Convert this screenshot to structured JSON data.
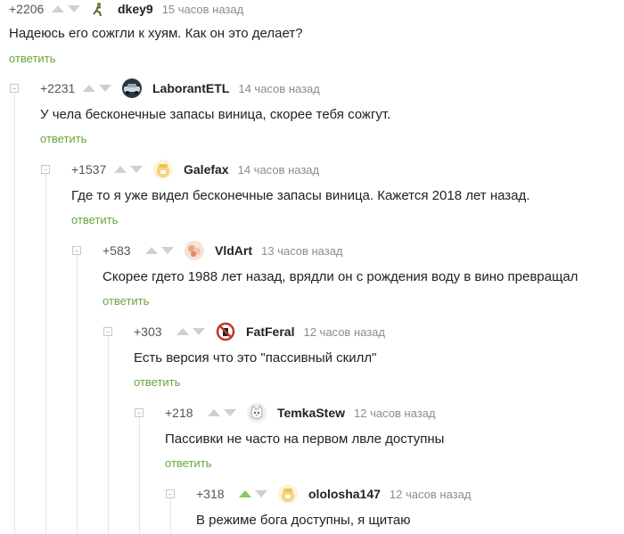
{
  "comments": [
    {
      "rating": "+2206",
      "author": "dkey9",
      "time": "15 часов назад",
      "text": "Надеюсь его сожгли к хуям. Как он это делает?",
      "reply": "ответить",
      "avatar_icon": "runner-avatar"
    },
    {
      "rating": "+2231",
      "author": "LaborantETL",
      "time": "14 часов назад",
      "text": "У чела бесконечные запасы виница, скорее тебя сожгут.",
      "reply": "ответить",
      "avatar_icon": "car-avatar"
    },
    {
      "rating": "+1537",
      "author": "Galefax",
      "time": "14 часов назад",
      "text": "Где то я уже видел бесконечные запасы виница. Кажется 2018 лет назад.",
      "reply": "ответить",
      "avatar_icon": "default-avatar"
    },
    {
      "rating": "+583",
      "author": "VldArt",
      "time": "13 часов назад",
      "text": "Скорее гдето 1988 лет назад, врядли он с рождения воду в вино превращал",
      "reply": "ответить",
      "avatar_icon": "floral-avatar"
    },
    {
      "rating": "+303",
      "author": "FatFeral",
      "time": "12 часов назад",
      "text": "Есть версия что это \"пассивный скилл\"",
      "reply": "ответить",
      "avatar_icon": "no-sign-avatar"
    },
    {
      "rating": "+218",
      "author": "TemkaStew",
      "time": "12 часов назад",
      "text": "Пассивки не часто на первом лвле доступны",
      "reply": "ответить",
      "avatar_icon": "cat-avatar"
    },
    {
      "rating": "+318",
      "author": "ololosha147",
      "time": "12 часов назад",
      "text": "В режиме бога доступны, я щитаю",
      "reply": "",
      "avatar_icon": "default-avatar",
      "upvoted": true
    }
  ],
  "colors": {
    "reply": "#66a638",
    "upvote_active": "#8ac858"
  }
}
